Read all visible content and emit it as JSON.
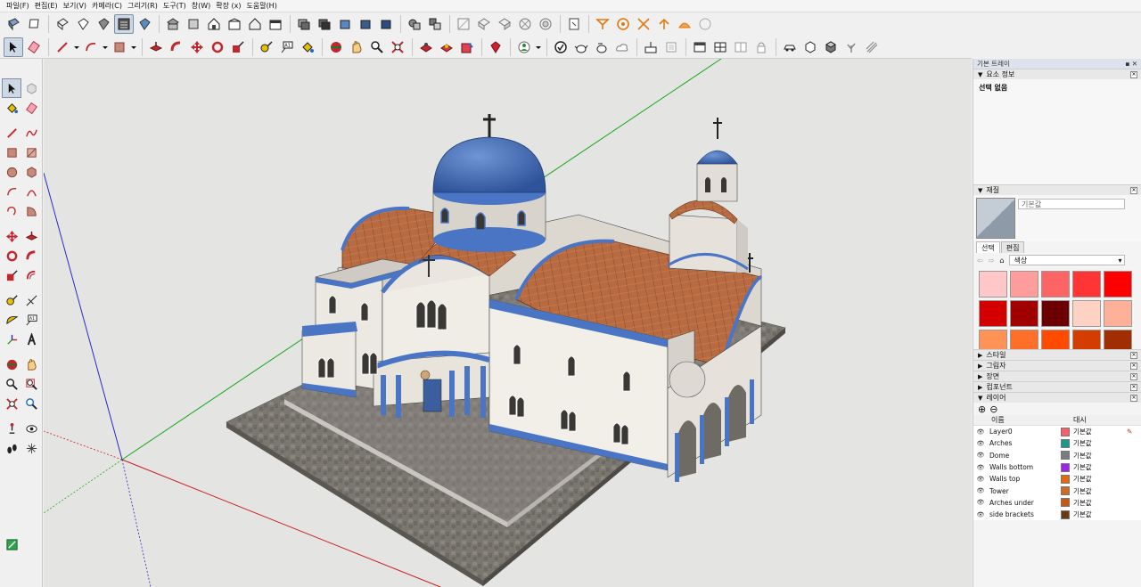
{
  "menu": [
    "파일(F)",
    "편집(E)",
    "보기(V)",
    "카메라(C)",
    "그리기(R)",
    "도구(T)",
    "창(W)",
    "확장 (x)",
    "도움말(H)"
  ],
  "tray": {
    "title": "기본 트레이",
    "entity_info": {
      "title": "요소 정보",
      "content": "선택 없음"
    },
    "materials": {
      "title": "재질",
      "material_name": "기본값",
      "tabs": [
        "선택",
        "편집"
      ],
      "library": "색상",
      "swatches": [
        "#ffc7c7",
        "#ff9d9d",
        "#ff6464",
        "#ff3535",
        "#ff0000",
        "#d40000",
        "#a00000",
        "#6b0000",
        "#ffd2c4",
        "#ffb098",
        "#ff9257",
        "#ff6f2a",
        "#ff4a00",
        "#d43d00",
        "#a02e00"
      ]
    },
    "collapsed_panels": [
      "스타일",
      "그림자",
      "장면",
      "컴포넌트"
    ],
    "layers": {
      "title": "레이어",
      "col_name": "이름",
      "col_style": "대시",
      "rows": [
        {
          "name": "Layer0",
          "color": "#ff5c6b",
          "style": "기본값"
        },
        {
          "name": "Arches",
          "color": "#1a9a8c",
          "style": "기본값"
        },
        {
          "name": "Dome",
          "color": "#7a7d80",
          "style": "기본값"
        },
        {
          "name": "Walls bottom",
          "color": "#a020f0",
          "style": "기본값"
        },
        {
          "name": "Walls top",
          "color": "#e06b0a",
          "style": "기본값"
        },
        {
          "name": "Tower",
          "color": "#d2691e",
          "style": "기본값"
        },
        {
          "name": "Arches under",
          "color": "#c85a10",
          "style": "기본값"
        },
        {
          "name": "side brackets",
          "color": "#6b3a12",
          "style": "기본값"
        }
      ]
    }
  },
  "viewport": {
    "axis_colors": {
      "red": "#cc1b1b",
      "green": "#1aa51a",
      "blue": "#2828c8"
    },
    "model": "greek-orthodox-church",
    "colors": {
      "dome": "#4a70b8",
      "roof": "#b8683e",
      "wall": "#e9e6df",
      "trim": "#4a74c4",
      "ground": "#7a7670"
    }
  }
}
